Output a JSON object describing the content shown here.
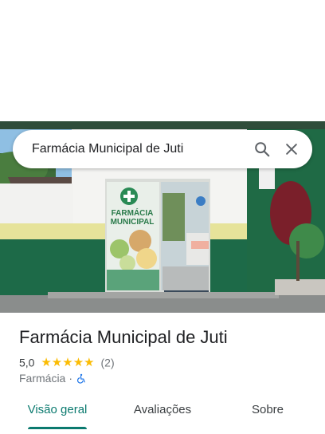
{
  "search": {
    "query": "Farmácia Municipal de Juti"
  },
  "photo": {
    "sign_line1": "FARMÁCIA",
    "sign_line2": "MUNICIPAL"
  },
  "place": {
    "name": "Farmácia Municipal de Juti",
    "rating": "5,0",
    "stars": "★★★★★",
    "review_count": "(2)",
    "category": "Farmácia",
    "separator": "·"
  },
  "tabs": [
    {
      "label": "Visão geral",
      "active": true
    },
    {
      "label": "Avaliações",
      "active": false
    },
    {
      "label": "Sobre",
      "active": false
    }
  ],
  "colors": {
    "accent": "#0b7a6f",
    "star": "#fbbc04",
    "accessibility": "#1a73e8"
  },
  "icons": {
    "search": "search-icon",
    "close": "close-icon",
    "accessibility": "wheelchair-icon"
  }
}
